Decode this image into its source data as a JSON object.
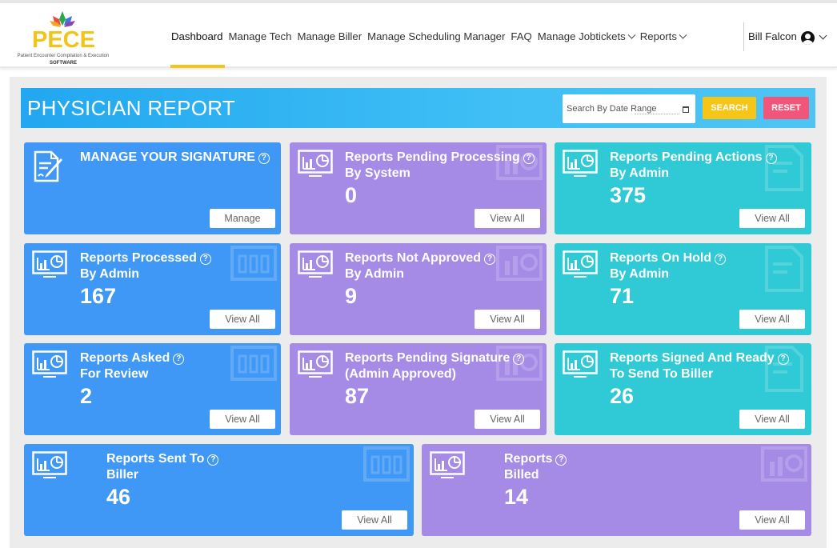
{
  "logo": {
    "name": "PECE",
    "subtitle": "Patient Encounter Compilation & Execution",
    "tag": "SOFTWARE"
  },
  "nav": [
    {
      "label": "Dashboard",
      "dropdown": false
    },
    {
      "label": "Manage Tech",
      "dropdown": false
    },
    {
      "label": "Manage Biller",
      "dropdown": false
    },
    {
      "label": "Manage Scheduling Manager",
      "dropdown": false
    },
    {
      "label": "FAQ",
      "dropdown": false
    },
    {
      "label": "Manage Jobtickets",
      "dropdown": true
    },
    {
      "label": "Reports",
      "dropdown": true
    }
  ],
  "user": {
    "name": "Bill Falcon"
  },
  "page": {
    "title": "PHYSICIAN REPORT"
  },
  "search": {
    "placeholder": "Search By Date Range",
    "search_label": "SEARCH",
    "reset_label": "RESET"
  },
  "cards": {
    "signature": {
      "title": "MANAGE YOUR SIGNATURE",
      "button": "Manage"
    },
    "pending_processing": {
      "line1": "Reports Pending Processing",
      "line2": "By System",
      "count": "0",
      "button": "View All"
    },
    "pending_actions": {
      "line1": "Reports Pending Actions",
      "line2": "By Admin",
      "count": "375",
      "button": "View All"
    },
    "processed": {
      "line1": "Reports Processed",
      "line2": "By Admin",
      "count": "167",
      "button": "View All"
    },
    "not_approved": {
      "line1": "Reports Not Approved",
      "line2": "By Admin",
      "count": "9",
      "button": "View All"
    },
    "on_hold": {
      "line1": "Reports On Hold",
      "line2": "By Admin",
      "count": "71",
      "button": "View All"
    },
    "asked_review": {
      "line1": "Reports Asked",
      "line2": "For Review",
      "count": "2",
      "button": "View All"
    },
    "pending_signature": {
      "line1": "Reports Pending Signature",
      "line2": "(Admin Approved)",
      "count": "87",
      "button": "View All"
    },
    "signed_ready": {
      "line1": "Reports Signed And Ready",
      "line2": "To Send To Biller",
      "count": "26",
      "button": "View All"
    },
    "sent_biller": {
      "line1": "Reports Sent To",
      "line2": "Biller",
      "count": "46",
      "button": "View All"
    },
    "billed": {
      "line1": "Reports",
      "line2": "Billed",
      "count": "14",
      "button": "View All"
    }
  },
  "colors": {
    "blue": "#3f98f5",
    "purple": "#a58ae6",
    "teal": "#2fcad6",
    "accent": "#f5c518",
    "reset": "#f0567a",
    "header": "#22a7f0"
  }
}
